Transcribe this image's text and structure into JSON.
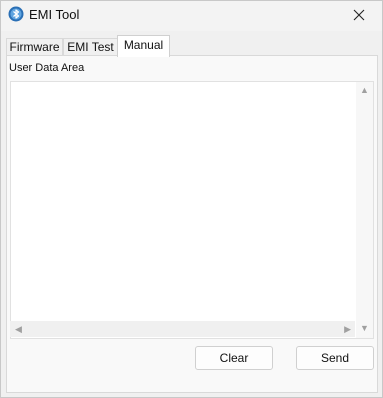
{
  "window": {
    "title": "EMI Tool",
    "icon": "bluetooth-globe-icon",
    "close_icon": "close-icon"
  },
  "tabs": [
    {
      "label": "Firmware",
      "active": false
    },
    {
      "label": "EMI Test",
      "active": false
    },
    {
      "label": "Manual",
      "active": true
    }
  ],
  "manual": {
    "section_label": "User Data Area",
    "user_data_value": "",
    "buttons": {
      "clear_label": "Clear",
      "send_label": "Send"
    }
  },
  "colors": {
    "window_bg": "#f0f0f0",
    "panel_bg": "#f9f9f9",
    "border": "#d0d0d0",
    "text": "#111111"
  }
}
